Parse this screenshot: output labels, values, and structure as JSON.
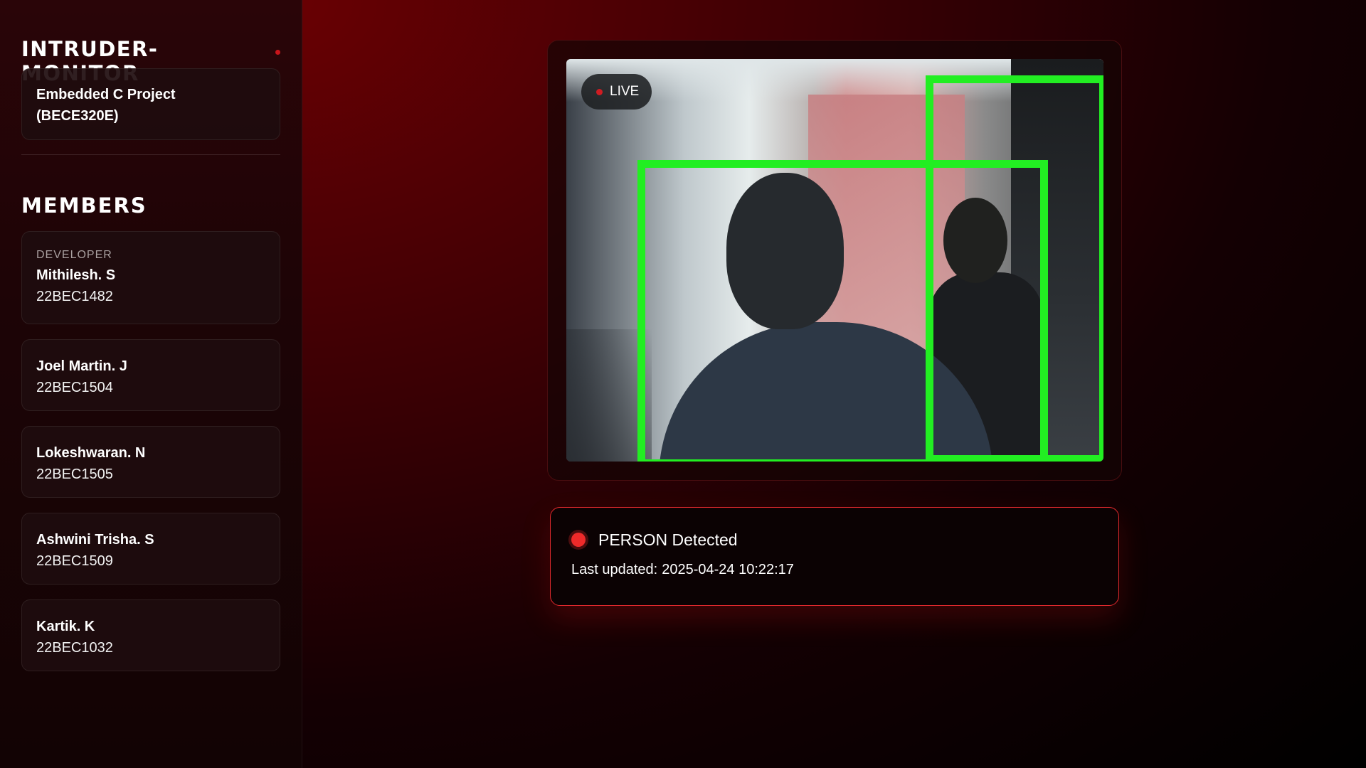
{
  "sidebar": {
    "brand": "INTRUDER-MONITOR",
    "project": {
      "line1": "Embedded C Project",
      "line2": "(BECE320E)"
    },
    "members_title": "MEMBERS",
    "members": [
      {
        "role": "DEVELOPER",
        "name": "Mithilesh. S",
        "id": "22BEC1482"
      },
      {
        "name": "Joel Martin. J",
        "id": "22BEC1504"
      },
      {
        "name": "Lokeshwaran. N",
        "id": "22BEC1505"
      },
      {
        "name": "Ashwini Trisha. S",
        "id": "22BEC1509"
      },
      {
        "name": "Kartik. K",
        "id": "22BEC1032"
      }
    ]
  },
  "video": {
    "live_label": "LIVE",
    "detection_box_color": "#22ee22"
  },
  "status": {
    "message": "PERSON Detected",
    "updated_label": "Last updated:",
    "updated_value": "2025-04-24 10:22:17",
    "indicator_color": "#ee2a2a"
  },
  "colors": {
    "accent": "#c8151b",
    "card_border": "#e0292d"
  }
}
